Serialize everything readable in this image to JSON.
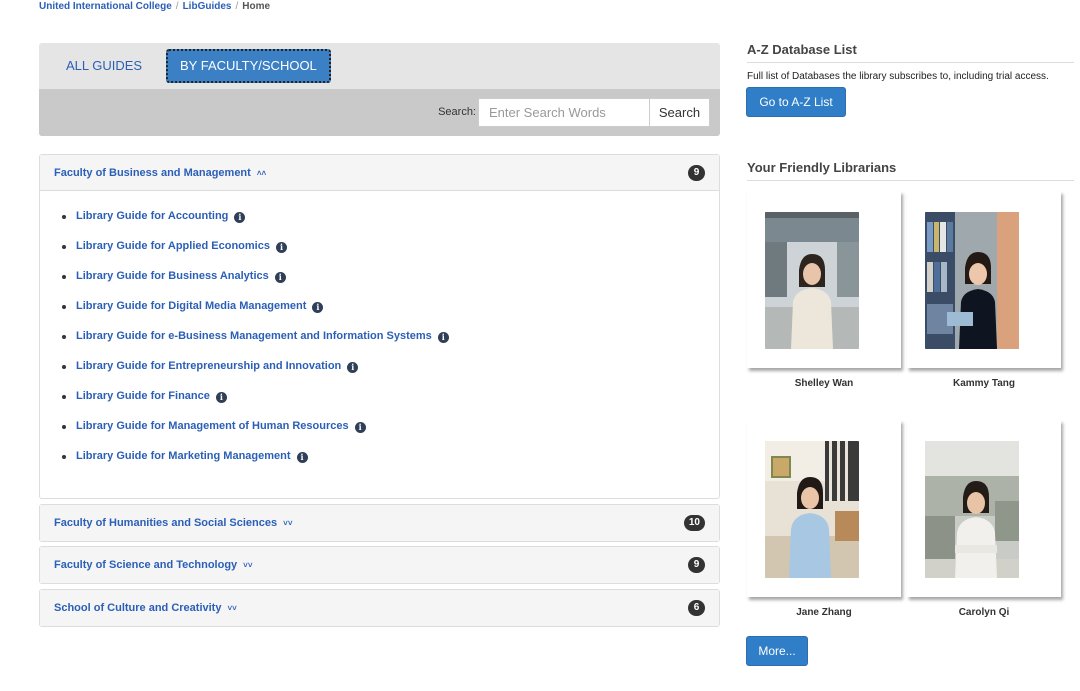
{
  "breadcrumb": {
    "items": [
      "United International College",
      "LibGuides"
    ],
    "current": "Home",
    "separator": "/"
  },
  "guides_tabs": {
    "all_label": "ALL GUIDES",
    "faculty_label": "BY FACULTY/SCHOOL",
    "active": "BY FACULTY/SCHOOL"
  },
  "search": {
    "label": "Search:",
    "placeholder": "Enter Search Words",
    "value": "",
    "button_label": "Search"
  },
  "faculties": [
    {
      "title": "Faculty of Business and Management",
      "count": "9",
      "expanded": true,
      "guides": [
        "Library Guide for Accounting",
        "Library Guide for Applied Economics",
        "Library Guide for Business Analytics",
        "Library Guide for Digital Media Management",
        "Library Guide for e-Business Management and Information Systems",
        "Library Guide for Entrepreneurship and Innovation",
        "Library Guide for Finance",
        "Library Guide for Management of Human Resources",
        "Library Guide for Marketing Management"
      ]
    },
    {
      "title": "Faculty of Humanities and Social Sciences",
      "count": "10",
      "expanded": false
    },
    {
      "title": "Faculty of Science and Technology",
      "count": "9",
      "expanded": false
    },
    {
      "title": "School of Culture and Creativity",
      "count": "6",
      "expanded": false
    }
  ],
  "az_database": {
    "title": "A-Z Database List",
    "description": "Full list of Databases the library subscribes to, including trial access.",
    "button_label": "Go to A-Z List"
  },
  "librarians": {
    "title": "Your Friendly Librarians",
    "people": [
      {
        "name": "Shelley Wan"
      },
      {
        "name": "Kammy Tang"
      },
      {
        "name": "Jane Zhang"
      },
      {
        "name": "Carolyn Qi"
      }
    ],
    "more_label": "More..."
  },
  "colors": {
    "link": "#2b5fb7",
    "accent_button": "#2f7ec7",
    "badge": "#333333"
  },
  "icons": {
    "info": "info-circle-icon",
    "chevron_up": "chevron-double-up-icon",
    "chevron_down": "chevron-double-down-icon"
  }
}
